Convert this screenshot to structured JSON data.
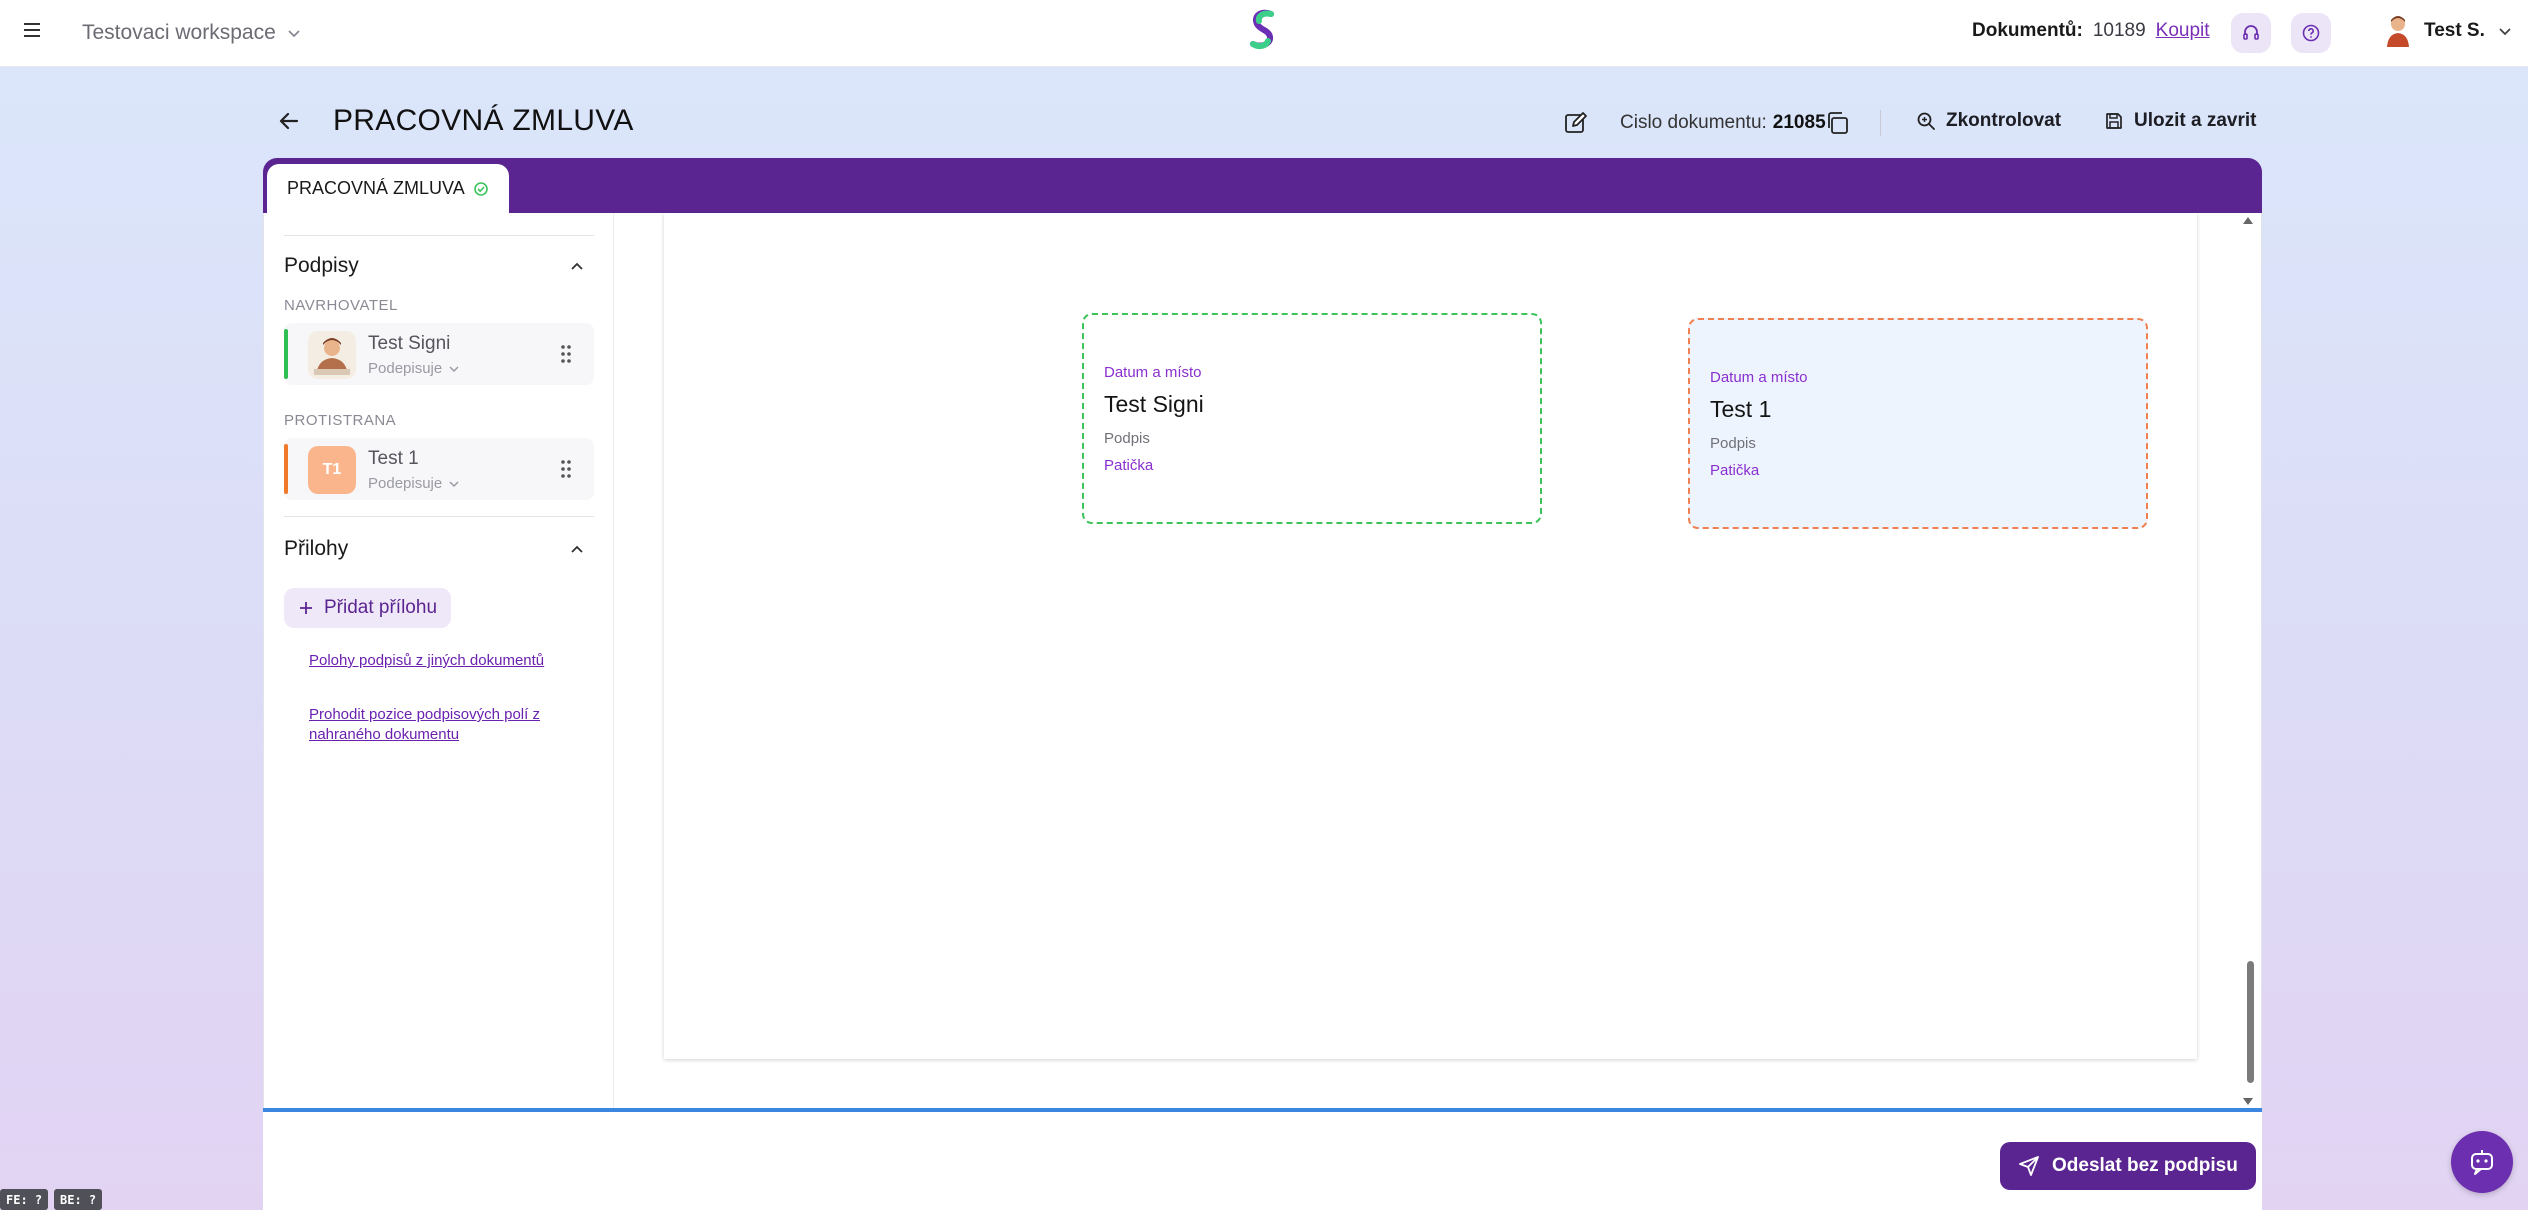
{
  "topbar": {
    "workspace": "Testovaci workspace",
    "docs_label": "Dokumentů:",
    "docs_count": "10189",
    "buy_label": "Koupit",
    "user_name": "Test S.",
    "icons": [
      "menu-icon",
      "headset-icon",
      "help-icon",
      "chevron-down-icon"
    ]
  },
  "header": {
    "title": "PRACOVNÁ ZMLUVA",
    "doc_number_label": "Cislo dokumentu:",
    "doc_number": "21085",
    "check_label": "Zkontrolovat",
    "save_label": "Ulozit a zavrit"
  },
  "tab": {
    "label": "PRACOVNÁ ZMLUVA"
  },
  "sidebar": {
    "signatures_title": "Podpisy",
    "proposer_label": "NAVRHOVATEL",
    "counterparty_label": "PROTISTRANA",
    "signers": [
      {
        "name": "Test Signi",
        "status": "Podepisuje",
        "initials": "",
        "color": "#2fbf52"
      },
      {
        "name": "Test 1",
        "status": "Podepisuje",
        "initials": "T1",
        "color": "#f07a2a"
      }
    ],
    "attachments_title": "Přilohy",
    "add_attachment": "Přidat přílohu",
    "link_positions": "Polohy podpisů z jiných dokumentů",
    "link_swap": "Prohodit pozice podpisových polí z nahraného dokumentu"
  },
  "document": {
    "boxes": [
      {
        "date_place": "Datum a místo",
        "name": "Test Signi",
        "signature": "Podpis",
        "footer": "Patička",
        "border_color": "#3cc45a"
      },
      {
        "date_place": "Datum a místo",
        "name": "Test 1",
        "signature": "Podpis",
        "footer": "Patička",
        "border_color": "#f08050"
      }
    ]
  },
  "footer": {
    "send_label": "Odeslat bez podpisu"
  },
  "debug": {
    "fe": "FE: ?",
    "be": "BE: ?"
  },
  "colors": {
    "primary": "#5b2591",
    "link": "#6a21b0",
    "progress": "#3b86e0"
  }
}
